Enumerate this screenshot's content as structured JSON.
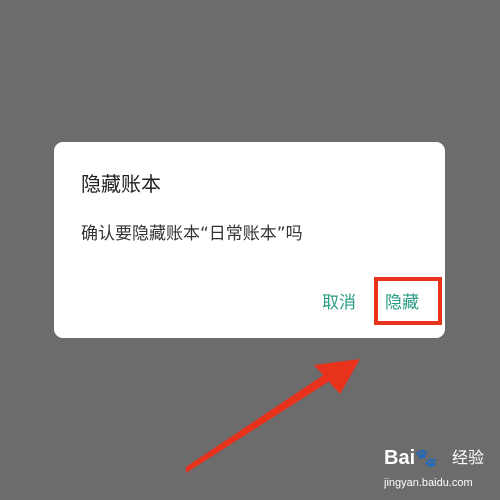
{
  "dialog": {
    "title": "隐藏账本",
    "message": "确认要隐藏账本“日常账本”吗",
    "cancel_label": "取消",
    "confirm_label": "隐藏"
  },
  "colors": {
    "background": "#6c6c6c",
    "button_text": "#2a9c84",
    "annotation": "#e8321c"
  },
  "annotation": {
    "arrow_icon": "arrow-up-right",
    "highlight_target": "confirm_label"
  },
  "watermark": {
    "logo_text": "Bai",
    "logo_paw": "🐾",
    "brand_cn": "经验",
    "url": "jingyan.baidu.com"
  }
}
